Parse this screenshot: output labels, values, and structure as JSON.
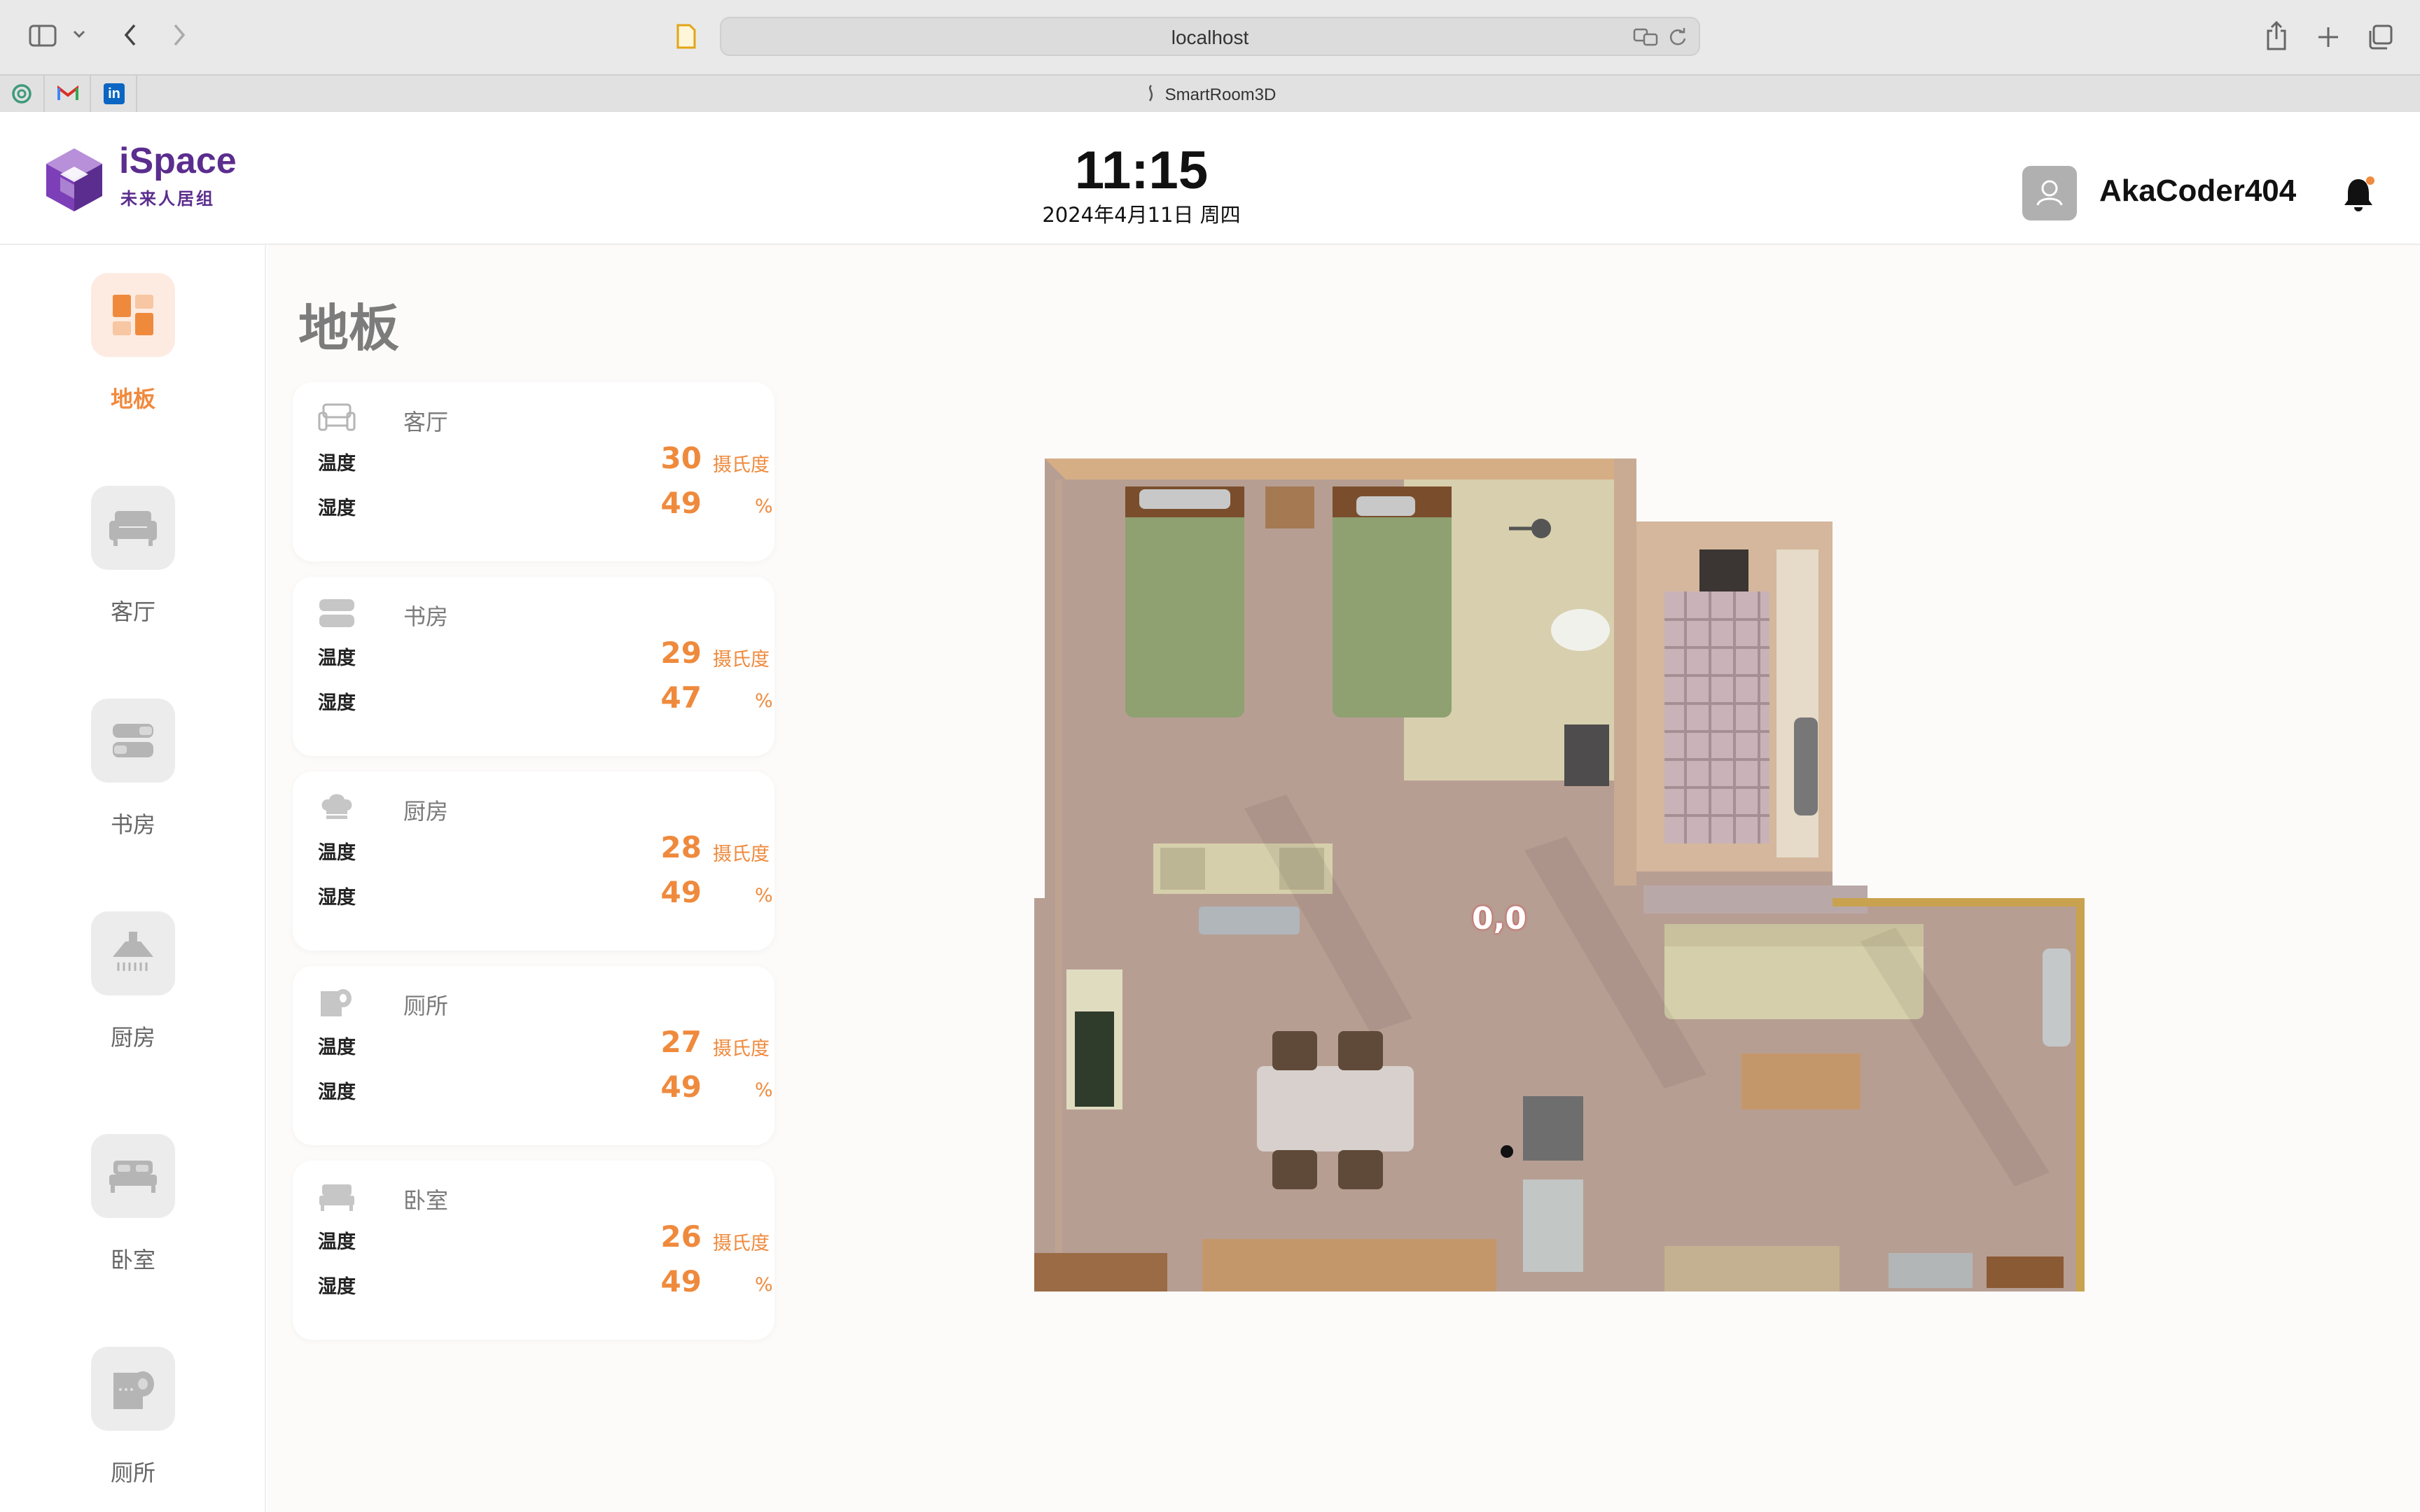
{
  "browser": {
    "url": "localhost",
    "tab_title": "SmartRoom3D",
    "favicons": [
      "chatgpt-icon",
      "gmail-icon",
      "linkedin-icon"
    ],
    "linkedin_glyph": "in"
  },
  "header": {
    "brand_name": "iSpace",
    "brand_sub": "未来人居组",
    "time": "11:15",
    "date": "2024年4月11日 周四",
    "username": "AkaCoder404",
    "accent_color": "#f08a3e",
    "brand_color": "#5b2d8e"
  },
  "sidebar": {
    "items": [
      {
        "label": "地板",
        "icon": "floor-grid-icon",
        "active": true
      },
      {
        "label": "客厅",
        "icon": "sofa-icon",
        "active": false
      },
      {
        "label": "书房",
        "icon": "books-icon",
        "active": false
      },
      {
        "label": "厨房",
        "icon": "range-hood-icon",
        "active": false
      },
      {
        "label": "卧室",
        "icon": "bed-icon",
        "active": false
      },
      {
        "label": "厕所",
        "icon": "toilet-paper-icon",
        "active": false
      }
    ]
  },
  "main": {
    "title": "地板",
    "temp_label": "温度",
    "humidity_label": "湿度",
    "temp_unit": "摄氏度",
    "humidity_unit": "%",
    "rooms": [
      {
        "name": "客厅",
        "icon": "sofa-icon",
        "temp": "30",
        "humidity": "49"
      },
      {
        "name": "书房",
        "icon": "books-icon",
        "temp": "29",
        "humidity": "47"
      },
      {
        "name": "厨房",
        "icon": "chef-hat-icon",
        "temp": "28",
        "humidity": "49"
      },
      {
        "name": "厕所",
        "icon": "toilet-paper-icon",
        "temp": "27",
        "humidity": "49"
      },
      {
        "name": "卧室",
        "icon": "bed-icon",
        "temp": "26",
        "humidity": "49"
      }
    ],
    "coords": "0,0"
  }
}
